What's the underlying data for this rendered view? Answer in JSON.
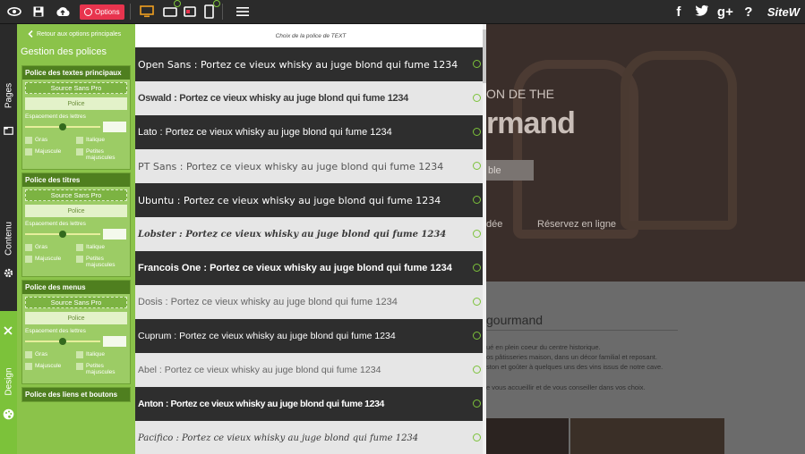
{
  "toolbar": {
    "options_label": "Options",
    "icons": [
      "eye-icon",
      "save-icon",
      "cloud-upload-icon",
      "desktop-icon",
      "tablet-landscape-icon",
      "mobile-icon",
      "menu-icon"
    ],
    "social": {
      "facebook": "f",
      "twitter": "t",
      "gplus": "g+",
      "help": "?"
    },
    "logo": "SiteW"
  },
  "side_tabs": {
    "pages": "Pages",
    "content": "Contenu",
    "design": "Design"
  },
  "panel": {
    "back_label": "Retour aux options principales",
    "title": "Gestion des polices",
    "sections": [
      {
        "heading": "Police des textes principaux",
        "font": "Source Sans Pro",
        "button": "Police",
        "spacing": "Espacement des lettres",
        "bold": "Gras",
        "italic": "Italique",
        "caps": "Majuscule",
        "small_caps": "Petites majuscules"
      },
      {
        "heading": "Police des titres",
        "font": "Source Sans Pro",
        "button": "Police",
        "spacing": "Espacement des lettres",
        "bold": "Gras",
        "italic": "Italique",
        "caps": "Majuscule",
        "small_caps": "Petites majuscules"
      },
      {
        "heading": "Police des menus",
        "font": "Source Sans Pro",
        "button": "Police",
        "spacing": "Espacement des lettres",
        "bold": "Gras",
        "italic": "Italique",
        "caps": "Majuscule",
        "small_caps": "Petites majuscules"
      },
      {
        "heading": "Police des liens et boutons"
      }
    ]
  },
  "font_list": {
    "header": "Choix de la police de TEXT",
    "rows": [
      {
        "label": "Open Sans : Portez ce vieux whisky au juge blond qui fume 1234",
        "style": "dark"
      },
      {
        "label": "Oswald : Portez ce vieux whisky au juge blond qui fume 1234",
        "style": "light"
      },
      {
        "label": "Lato : Portez ce vieux whisky au juge blond qui fume 1234",
        "style": "dark"
      },
      {
        "label": "PT Sans : Portez ce vieux whisky au juge blond qui fume 1234",
        "style": "light"
      },
      {
        "label": "Ubuntu : Portez ce vieux whisky au juge blond qui fume 1234",
        "style": "dark"
      },
      {
        "label": "Lobster : Portez ce vieux whisky au juge blond qui fume 1234",
        "style": "light"
      },
      {
        "label": "Francois One : Portez ce vieux whisky au juge blond qui fume 1234",
        "style": "dark"
      },
      {
        "label": "Dosis : Portez ce vieux whisky au juge blond qui fume 1234",
        "style": "light"
      },
      {
        "label": "Cuprum : Portez ce vieux whisky au juge blond qui fume 1234",
        "style": "dark"
      },
      {
        "label": "Abel : Portez ce vieux whisky au juge blond qui fume 1234",
        "style": "light"
      },
      {
        "label": "Anton : Portez ce vieux whisky au juge blond qui fume 1234",
        "style": "dark"
      },
      {
        "label": "Pacifico : Portez ce vieux whisky au juge blond qui fume 1234",
        "style": "light"
      }
    ]
  },
  "preview": {
    "hero_sub": "ON DE THE",
    "hero_title": "rmand",
    "hero_button": "ble",
    "nav_1": "dée",
    "nav_2": "Réservez en ligne",
    "section_title": "gourmand",
    "lines": [
      "ué en plein coeur du centre historique.",
      "os pâtisseries maison, dans un décor familial et reposant.",
      "ston et goûter à quelques uns des vins issus de notre cave.",
      "e vous accueillir et de vous conseiller dans vos choix."
    ]
  },
  "colors": {
    "accent_green": "#8bc34a",
    "dark_green": "#4f7f1f",
    "options_red": "#e8344e",
    "row_dark": "#2e2e2e",
    "row_light": "#e6e6e6"
  }
}
